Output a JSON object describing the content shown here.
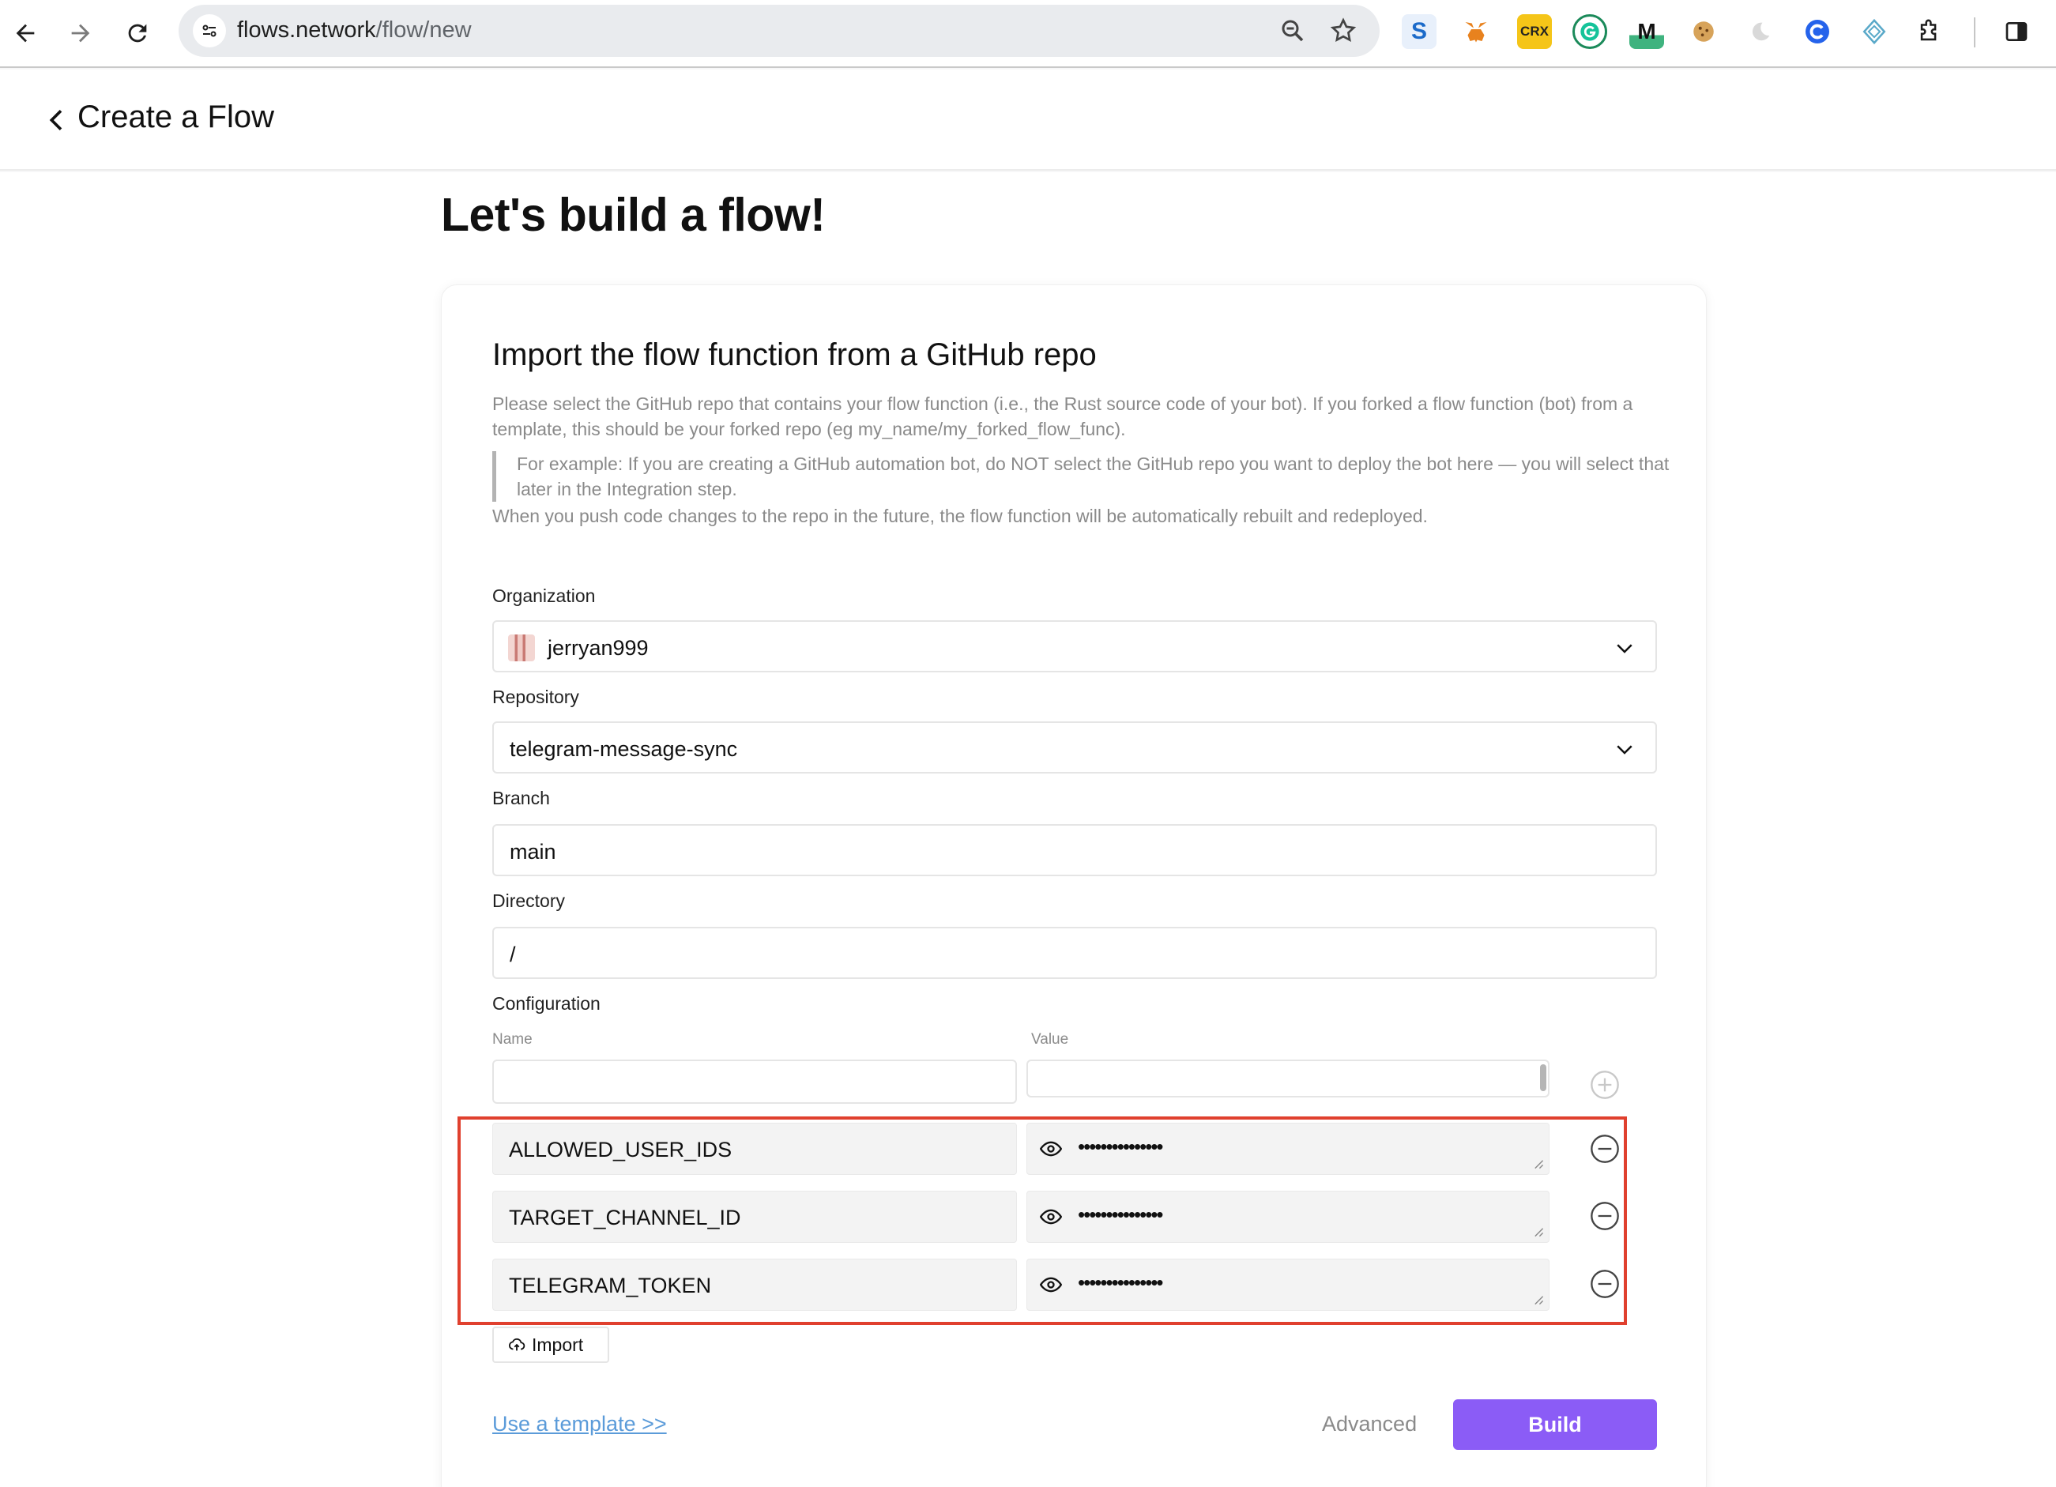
{
  "browser": {
    "url_host": "flows.network",
    "url_path": "/flow/new",
    "extensions": [
      "s-extension-icon",
      "metamask-fox-icon",
      "crx-icon",
      "grammarly-icon",
      "m-extension-icon",
      "cookie-icon",
      "moon-icon",
      "c-extension-icon",
      "diamond-extension-icon",
      "puzzle-icon"
    ],
    "ext_labels": {
      "crx": "CRX",
      "m": "M"
    }
  },
  "header": {
    "title": "Create a Flow"
  },
  "page": {
    "title": "Let's build a flow!"
  },
  "card": {
    "title": "Import the flow function from a GitHub repo",
    "description": "Please select the GitHub repo that contains your flow function (i.e., the Rust source code of your bot). If you forked a flow function (bot) from a template, this should be your forked repo (eg my_name/my_forked_flow_func).",
    "example": "For example: If you are creating a GitHub automation bot, do NOT select the GitHub repo you want to deploy the bot here — you will select that later in the Integration step.",
    "note": "When you push code changes to the repo in the future, the flow function will be automatically rebuilt and redeployed."
  },
  "form": {
    "organization": {
      "label": "Organization",
      "value": "jerryan999"
    },
    "repository": {
      "label": "Repository",
      "value": "telegram-message-sync"
    },
    "branch": {
      "label": "Branch",
      "value": "main"
    },
    "directory": {
      "label": "Directory",
      "value": "/"
    },
    "configuration": {
      "label": "Configuration",
      "name_header": "Name",
      "value_header": "Value",
      "rows": [
        {
          "name": "ALLOWED_USER_IDS",
          "value": "•••••••••••••••"
        },
        {
          "name": "TARGET_CHANNEL_ID",
          "value": "•••••••••••••••"
        },
        {
          "name": "TELEGRAM_TOKEN",
          "value": "•••••••••••••••"
        }
      ]
    },
    "import_label": "Import"
  },
  "footer": {
    "template_link": "Use a template >>",
    "advanced": "Advanced",
    "build": "Build"
  },
  "colors": {
    "accent": "#8b5cf6",
    "link": "#5b9bd9",
    "highlight": "#e0402e"
  }
}
